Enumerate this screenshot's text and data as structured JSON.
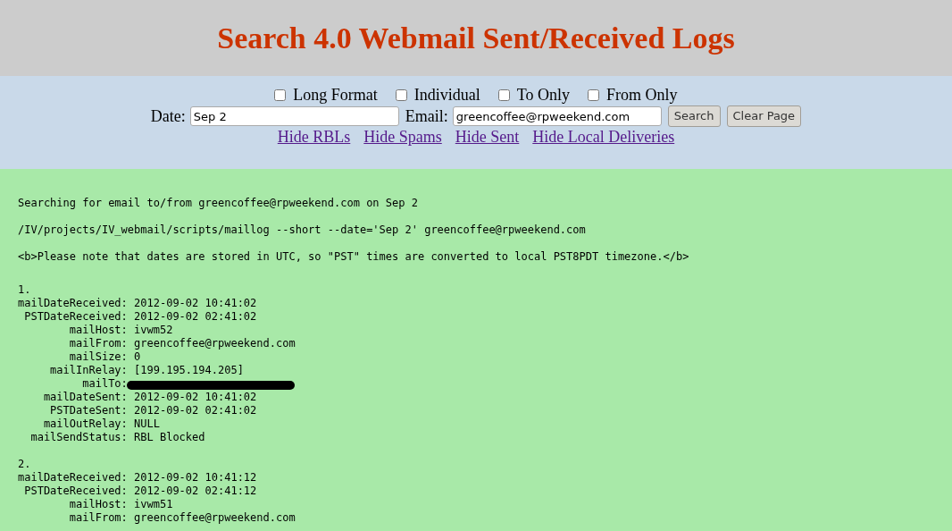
{
  "header": {
    "title": "Search 4.0 Webmail Sent/Received Logs"
  },
  "options": [
    {
      "label": "Long Format",
      "checked": false
    },
    {
      "label": "Individual",
      "checked": false
    },
    {
      "label": "To Only",
      "checked": false
    },
    {
      "label": "From Only",
      "checked": false
    }
  ],
  "form": {
    "date_label": "Date:",
    "date_value": "Sep 2",
    "email_label": "Email:",
    "email_value": "greencoffee@rpweekend.com",
    "buttons": [
      "Search",
      "Clear Page"
    ]
  },
  "links": [
    "Hide RBLs",
    "Hide Spams",
    "Hide Sent",
    "Hide Local Deliveries"
  ],
  "output": {
    "messages": [
      "Searching for email to/from greencoffee@rpweekend.com on Sep 2",
      "/IV/projects/IV_webmail/scripts/maillog --short --date='Sep 2' greencoffee@rpweekend.com",
      "<b>Please note that dates are stored in UTC, so \"PST\" times are converted to local PST8PDT timezone.</b>"
    ],
    "records": [
      {
        "number": "1.",
        "fields": [
          {
            "label": "mailDateReceived:",
            "value": "2012-09-02 10:41:02",
            "redacted": false
          },
          {
            "label": "PSTDateReceived:",
            "value": "2012-09-02 02:41:02",
            "redacted": false
          },
          {
            "label": "mailHost:",
            "value": "ivwm52",
            "redacted": false
          },
          {
            "label": "mailFrom:",
            "value": "greencoffee@rpweekend.com",
            "redacted": false
          },
          {
            "label": "mailSize:",
            "value": "0",
            "redacted": false
          },
          {
            "label": "mailInRelay:",
            "value": "[199.195.194.205]",
            "redacted": false
          },
          {
            "label": "mailTo:",
            "redacted": true
          },
          {
            "label": "mailDateSent:",
            "value": "2012-09-02 10:41:02",
            "redacted": false
          },
          {
            "label": "PSTDateSent:",
            "value": "2012-09-02 02:41:02",
            "redacted": false
          },
          {
            "label": "mailOutRelay:",
            "value": "NULL",
            "redacted": false
          },
          {
            "label": "mailSendStatus:",
            "value": "RBL Blocked",
            "redacted": false
          }
        ]
      },
      {
        "number": "2.",
        "fields": [
          {
            "label": "mailDateReceived:",
            "value": "2012-09-02 10:41:12",
            "redacted": false
          },
          {
            "label": "PSTDateReceived:",
            "value": "2012-09-02 02:41:12",
            "redacted": false
          },
          {
            "label": "mailHost:",
            "value": "ivwm51",
            "redacted": false
          },
          {
            "label": "mailFrom:",
            "value": "greencoffee@rpweekend.com",
            "redacted": false
          }
        ]
      }
    ]
  }
}
